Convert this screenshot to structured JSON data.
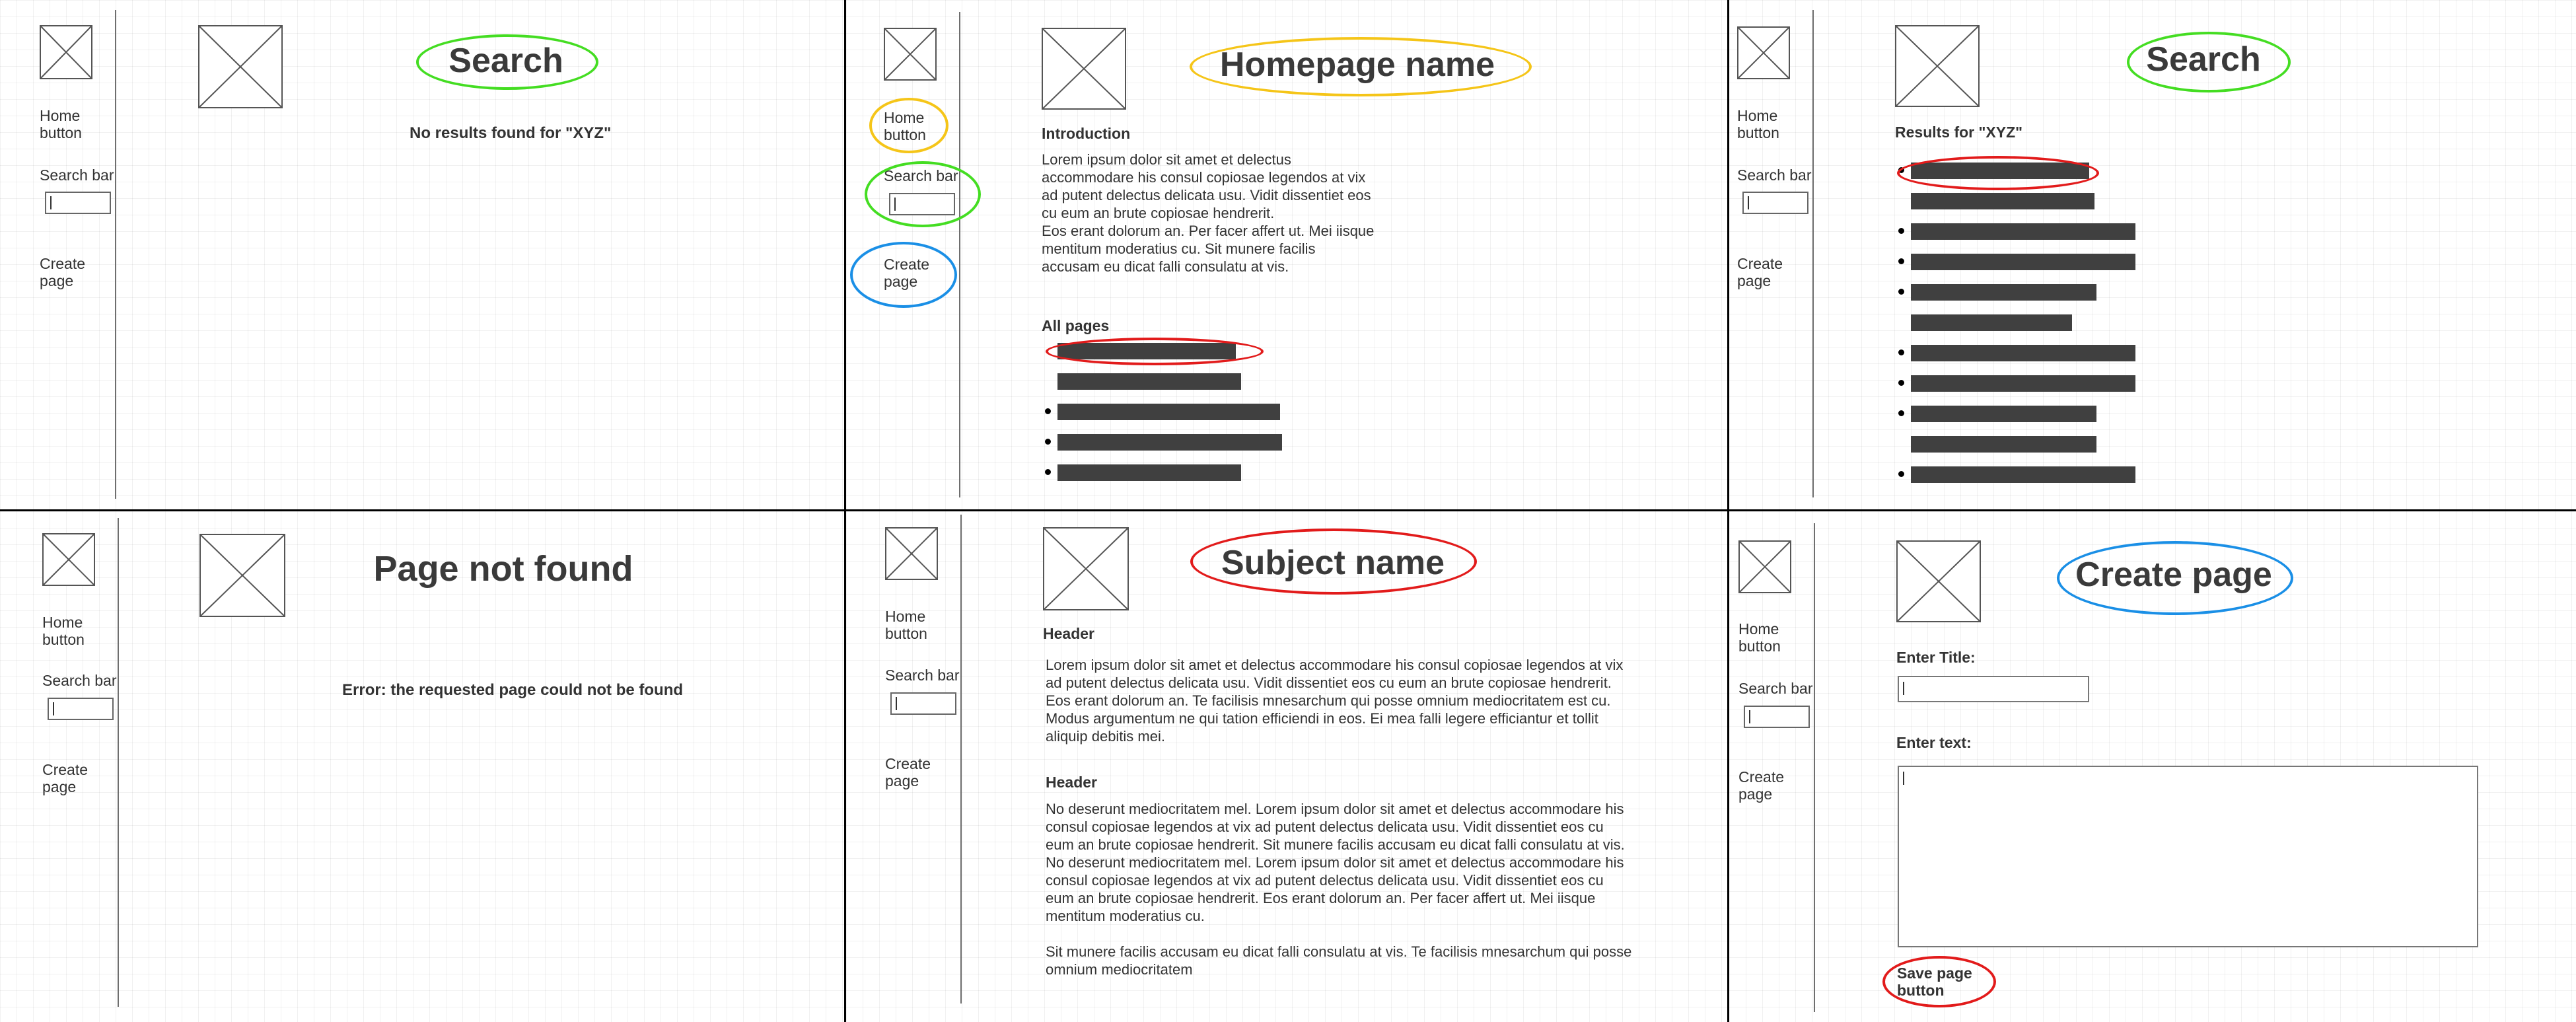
{
  "colors": {
    "annotation_green": "#44dd22",
    "annotation_yellow": "#f5c518",
    "annotation_blue": "#1a8fe6",
    "annotation_red": "#e21b1b",
    "placeholder_bar": "#404040",
    "panel_divider": "#000000"
  },
  "nav": {
    "home": [
      "Home",
      "button"
    ],
    "search": "Search bar",
    "create": [
      "Create",
      "page"
    ]
  },
  "screens": {
    "search_empty": {
      "title": "Search",
      "message": "No results found for \"XYZ\""
    },
    "homepage": {
      "title": "Homepage name",
      "intro_heading": "Introduction",
      "intro_text": "Lorem ipsum dolor sit amet et delectus accommodare his consul copiosae legendos at vix ad putent delectus delicata usu. Vidit dissentiet eos cu eum an brute copiosae hendrerit.\nEos erant dolorum an. Per facer affert ut. Mei iisque mentitum moderatius cu. Sit munere facilis accusam eu dicat falli consulatu at vis.",
      "all_pages_heading": "All pages",
      "pages": [
        {
          "width": 0.73,
          "bullet": false
        },
        {
          "width": 0.75,
          "bullet": false
        },
        {
          "width": 0.91,
          "bullet": true
        },
        {
          "width": 0.92,
          "bullet": true
        },
        {
          "width": 0.75,
          "bullet": true
        }
      ]
    },
    "search_results": {
      "title": "Search",
      "results_heading": "Results for \"XYZ\"",
      "results": [
        {
          "width": 0.73,
          "bullet": true
        },
        {
          "width": 0.75,
          "bullet": false
        },
        {
          "width": 0.92,
          "bullet": true
        },
        {
          "width": 0.92,
          "bullet": true
        },
        {
          "width": 0.76,
          "bullet": true
        },
        {
          "width": 0.66,
          "bullet": false
        },
        {
          "width": 0.92,
          "bullet": true
        },
        {
          "width": 0.92,
          "bullet": true
        },
        {
          "width": 0.76,
          "bullet": true
        },
        {
          "width": 0.76,
          "bullet": false
        },
        {
          "width": 0.92,
          "bullet": true
        }
      ]
    },
    "not_found": {
      "title": "Page not found",
      "message": "Error: the requested page could not be found"
    },
    "subject": {
      "title": "Subject name",
      "header1": "Header",
      "text1": "Lorem ipsum dolor sit amet et delectus accommodare his consul copiosae legendos at vix ad putent delectus delicata usu. Vidit dissentiet eos cu eum an brute copiosae hendrerit. Eos erant dolorum an. Te facilisis mnesarchum qui posse omnium mediocritatem est cu. Modus argumentum ne qui tation efficiendi in eos. Ei mea falli legere efficiantur et tollit aliquip debitis mei.",
      "header2": "Header",
      "text2": "No deserunt mediocritatem mel. Lorem ipsum dolor sit amet et delectus accommodare his consul copiosae legendos at vix ad putent delectus delicata usu. Vidit dissentiet eos cu eum an brute copiosae hendrerit. Sit munere facilis accusam eu dicat falli consulatu at vis. No deserunt mediocritatem mel. Lorem ipsum dolor sit amet et delectus accommodare his consul copiosae legendos at vix ad putent delectus delicata usu. Vidit dissentiet eos cu eum an brute copiosae hendrerit. Eos erant dolorum an. Per facer affert ut. Mei iisque mentitum moderatius cu.",
      "text3": "Sit munere facilis accusam eu dicat falli consulatu at vis. Te facilisis mnesarchum qui posse omnium mediocritatem"
    },
    "create": {
      "title": "Create page",
      "title_label": "Enter Title:",
      "text_label": "Enter text:",
      "save_label": "Save page button"
    }
  }
}
